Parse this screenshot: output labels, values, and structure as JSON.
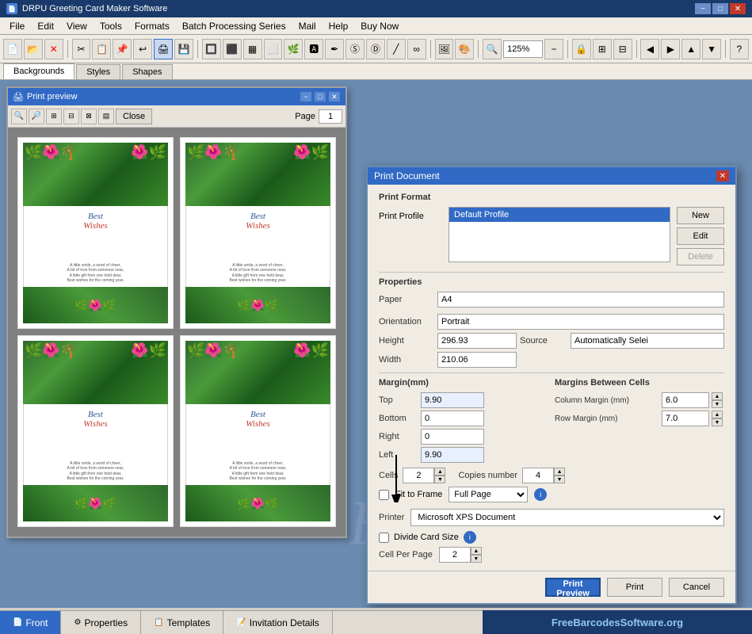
{
  "app": {
    "title": "DRPU Greeting Card Maker Software",
    "icon": "📄"
  },
  "titlebar": {
    "minimize": "−",
    "maximize": "□",
    "close": "✕"
  },
  "menubar": {
    "items": [
      "File",
      "Edit",
      "View",
      "Tools",
      "Formats",
      "Batch Processing Series",
      "Mail",
      "Help",
      "Buy Now"
    ]
  },
  "toolbar": {
    "zoom_value": "125%",
    "zoom_placeholder": "125%"
  },
  "tabs": {
    "items": [
      "Backgrounds",
      "Styles",
      "Shapes"
    ],
    "active": "Backgrounds"
  },
  "preview_window": {
    "title": "Print preview",
    "page_label": "Page",
    "page_value": "1",
    "close_btn": "X",
    "minimize_btn": "−",
    "maximize_btn": "□",
    "close_btn2": "✕",
    "toolbar_btn": "Close",
    "card": {
      "line1": "Best",
      "line2": "Wishes",
      "body": "A little smile, a word of cheer,\nA bit of love from someone near,\nA little gift from one held dear,\nBest wishes for the coming year."
    }
  },
  "print_dialog": {
    "title": "Print Document",
    "close": "✕",
    "section_format": "Print Format",
    "profile_label": "Print Profile",
    "profile_value": "Default Profile",
    "btn_new": "New",
    "btn_edit": "Edit",
    "btn_delete": "Delete",
    "section_properties": "Properties",
    "paper_label": "Paper",
    "paper_value": "A4",
    "orientation_label": "Orientation",
    "orientation_value": "Portrait",
    "height_label": "Height",
    "height_value": "296.93",
    "source_label": "Source",
    "source_value": "Automatically Selei",
    "width_label": "Width",
    "width_value": "210.06",
    "margin_label": "Margin(mm)",
    "top_label": "Top",
    "top_value": "9.90",
    "bottom_label": "Bottom",
    "bottom_value": "0",
    "right_label": "Right",
    "right_value": "0",
    "left_label": "Left",
    "left_value": "9.90",
    "margin_between_label": "Margins Between Cells",
    "col_margin_label": "Column Margin (mm)",
    "col_margin_value": "6.0",
    "row_margin_label": "Row Margin (mm)",
    "row_margin_value": "7.0",
    "cells_label": "Cells",
    "cells_value": "2",
    "copies_label": "Copies number",
    "copies_value": "4",
    "fit_to_frame_label": "Fit to Frame",
    "fit_to_frame_select": "Full Page",
    "info_icon": "i",
    "printer_label": "Printer",
    "printer_value": "Microsoft XPS Document",
    "divide_label": "Divide Card Size",
    "divide_info": "i",
    "cell_per_page_label": "Cell Per Page",
    "cell_per_page_value": "2",
    "btn_preview": "Print Preview",
    "btn_print": "Print",
    "btn_cancel": "Cancel"
  },
  "bottom_tabs": [
    {
      "label": "Front",
      "icon": "📄",
      "active": true
    },
    {
      "label": "Properties",
      "icon": "⚙"
    },
    {
      "label": "Templates",
      "icon": "📋"
    },
    {
      "label": "Invitation Details",
      "icon": "📝"
    }
  ],
  "bottom_right": {
    "text": "FreeBarcodesSoftware.org"
  }
}
